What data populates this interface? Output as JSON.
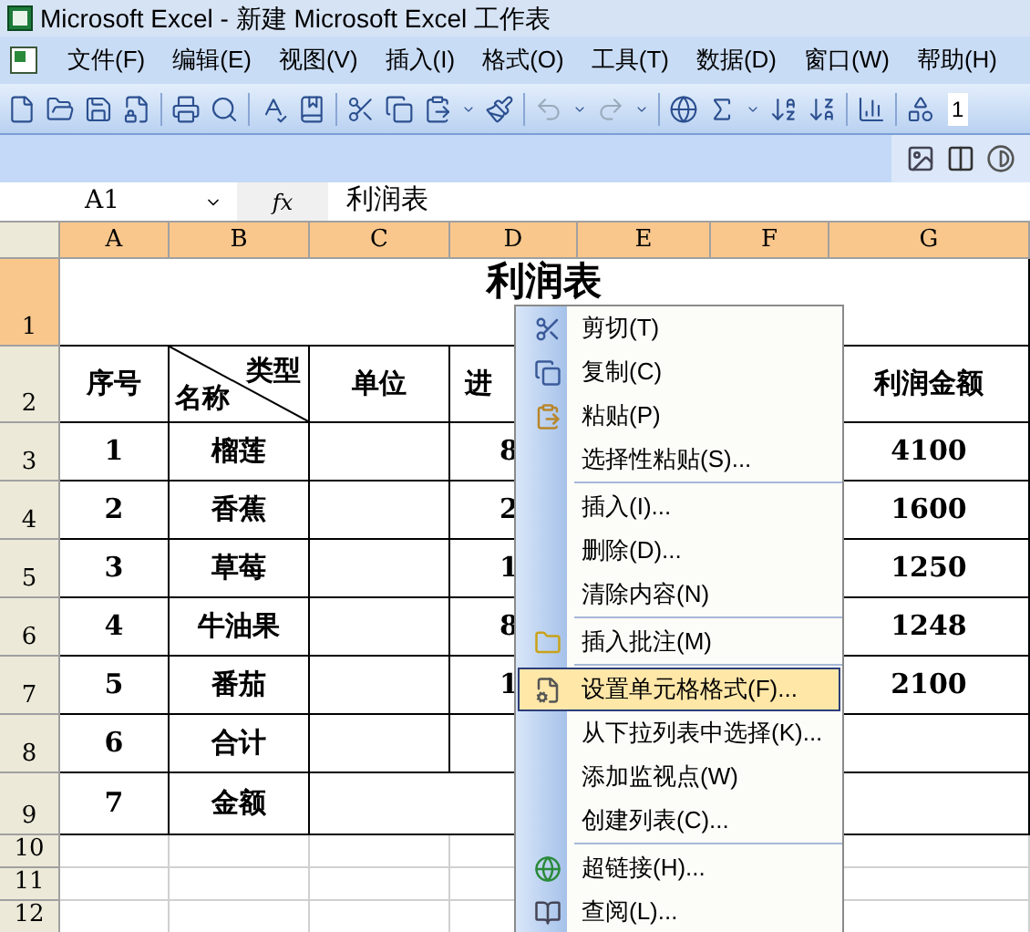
{
  "window": {
    "title": "Microsoft Excel - 新建 Microsoft Excel 工作表"
  },
  "menu_bar": [
    "文件(F)",
    "编辑(E)",
    "视图(V)",
    "插入(I)",
    "格式(O)",
    "工具(T)",
    "数据(D)",
    "窗口(W)",
    "帮助(H)"
  ],
  "toolbar": {
    "font_size": "1"
  },
  "formula_bar": {
    "name_box": "A1",
    "fx": "fx",
    "value": "利润表"
  },
  "columns": [
    {
      "label": "A",
      "selected": true
    },
    {
      "label": "B",
      "selected": true
    },
    {
      "label": "C",
      "selected": true
    },
    {
      "label": "D",
      "selected": true
    },
    {
      "label": "E",
      "selected": true
    },
    {
      "label": "F",
      "selected": true
    },
    {
      "label": "G",
      "selected": true
    }
  ],
  "rows": [
    {
      "label": "1",
      "selected": true
    },
    {
      "label": "2",
      "selected": false
    },
    {
      "label": "3",
      "selected": false
    },
    {
      "label": "4",
      "selected": false
    },
    {
      "label": "5",
      "selected": false
    },
    {
      "label": "6",
      "selected": false
    },
    {
      "label": "7",
      "selected": false
    },
    {
      "label": "8",
      "selected": false
    },
    {
      "label": "9",
      "selected": false
    },
    {
      "label": "10",
      "selected": false
    },
    {
      "label": "11",
      "selected": false
    },
    {
      "label": "12",
      "selected": false
    }
  ],
  "sheet": {
    "title": "利润表",
    "header": {
      "a": "序号",
      "b_top": "类型",
      "b_bottom": "名称",
      "c": "单位",
      "d": "进",
      "g": "利润金额"
    },
    "body": [
      {
        "a": "1",
        "b": "榴莲",
        "d": "8",
        "g": "4100"
      },
      {
        "a": "2",
        "b": "香蕉",
        "d": "2",
        "g": "1600"
      },
      {
        "a": "3",
        "b": "草莓",
        "d": "1",
        "g": "1250"
      },
      {
        "a": "4",
        "b": "牛油果",
        "d": "8",
        "g": "1248"
      },
      {
        "a": "5",
        "b": "番茄",
        "d": "1",
        "g": "2100"
      },
      {
        "a": "6",
        "b": "合计"
      },
      {
        "a": "7",
        "b": "金额"
      }
    ]
  },
  "context_menu": [
    {
      "kind": "item",
      "label": "剪切(T)",
      "selected": false
    },
    {
      "kind": "item",
      "label": "复制(C)",
      "selected": false
    },
    {
      "kind": "item",
      "label": "粘贴(P)",
      "selected": false
    },
    {
      "kind": "item",
      "label": "选择性粘贴(S)...",
      "selected": false
    },
    {
      "kind": "separator"
    },
    {
      "kind": "item",
      "label": "插入(I)...",
      "selected": false
    },
    {
      "kind": "item",
      "label": "删除(D)...",
      "selected": false
    },
    {
      "kind": "item",
      "label": "清除内容(N)",
      "selected": false
    },
    {
      "kind": "separator"
    },
    {
      "kind": "item",
      "label": "插入批注(M)",
      "selected": false
    },
    {
      "kind": "separator"
    },
    {
      "kind": "item",
      "label": "设置单元格格式(F)...",
      "selected": true
    },
    {
      "kind": "item",
      "label": "从下拉列表中选择(K)...",
      "selected": false
    },
    {
      "kind": "item",
      "label": "添加监视点(W)",
      "selected": false
    },
    {
      "kind": "item",
      "label": "创建列表(C)...",
      "selected": false
    },
    {
      "kind": "separator"
    },
    {
      "kind": "item",
      "label": "超链接(H)...",
      "selected": false
    },
    {
      "kind": "item",
      "label": "查阅(L)...",
      "selected": false
    }
  ]
}
